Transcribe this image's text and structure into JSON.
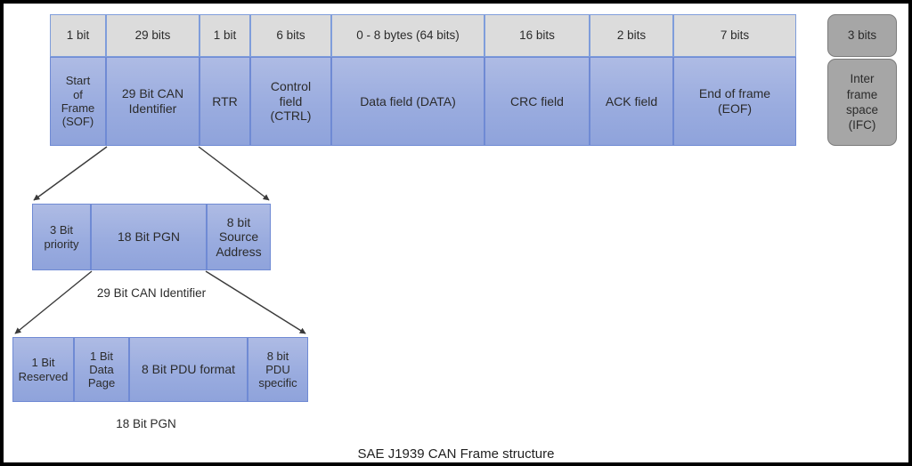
{
  "diagram": {
    "title": "SAE J1939 CAN Frame structure",
    "frame": {
      "fields": [
        {
          "bits": "1 bit",
          "name": "Start\nof\nFrame\n(SOF)"
        },
        {
          "bits": "29 bits",
          "name": "29 Bit CAN\nIdentifier"
        },
        {
          "bits": "1 bit",
          "name": "RTR"
        },
        {
          "bits": "6 bits",
          "name": "Control\nfield\n(CTRL)"
        },
        {
          "bits": "0 - 8 bytes (64 bits)",
          "name": "Data field (DATA)"
        },
        {
          "bits": "16 bits",
          "name": "CRC field"
        },
        {
          "bits": "2 bits",
          "name": "ACK field"
        },
        {
          "bits": "7 bits",
          "name": "End of frame\n(EOF)"
        }
      ],
      "trailer": {
        "bits": "3 bits",
        "name": "Inter\nframe\nspace\n(IFC)"
      }
    },
    "identifier_breakdown": {
      "caption": "29 Bit CAN Identifier",
      "fields": [
        {
          "name": "3 Bit\npriority"
        },
        {
          "name": "18 Bit PGN"
        },
        {
          "name": "8 bit\nSource\nAddress"
        }
      ]
    },
    "pgn_breakdown": {
      "caption": "18 Bit PGN",
      "fields": [
        {
          "name": "1 Bit\nReserved"
        },
        {
          "name": "1 Bit\nData\nPage"
        },
        {
          "name": "8 Bit PDU format"
        },
        {
          "name": "8 bit\nPDU\nspecific"
        }
      ]
    },
    "colors": {
      "header_fill": "#dcdcdc",
      "field_fill": "#9aacdf",
      "field_border": "#6f8ad4",
      "trailer_fill": "#a6a6a6",
      "trailer_border": "#7b7b7b",
      "connector": "#3a3a3a",
      "page_border": "#000000"
    }
  }
}
